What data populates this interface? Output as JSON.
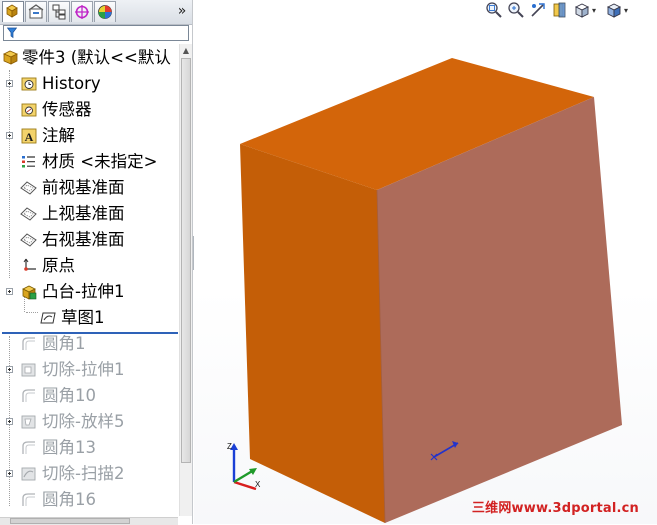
{
  "feature_tree": {
    "root": {
      "label": "零件3 (默认<<默认"
    },
    "items": [
      {
        "label": "History",
        "icon": "history-folder-icon",
        "state": "active"
      },
      {
        "label": "传感器",
        "icon": "sensors-icon",
        "state": "active"
      },
      {
        "label": "注解",
        "icon": "annotations-icon",
        "state": "active"
      },
      {
        "label": "材质 <未指定>",
        "icon": "material-icon",
        "state": "active"
      },
      {
        "label": "前视基准面",
        "icon": "plane-icon",
        "state": "active"
      },
      {
        "label": "上视基准面",
        "icon": "plane-icon",
        "state": "active"
      },
      {
        "label": "右视基准面",
        "icon": "plane-icon",
        "state": "active"
      },
      {
        "label": "原点",
        "icon": "origin-icon",
        "state": "active"
      },
      {
        "label": "凸台-拉伸1",
        "icon": "boss-extrude-icon",
        "state": "active"
      },
      {
        "label": "草图1",
        "icon": "sketch-icon",
        "state": "active"
      },
      {
        "label": "圆角1",
        "icon": "fillet-icon",
        "state": "suppressed"
      },
      {
        "label": "切除-拉伸1",
        "icon": "cut-extrude-icon",
        "state": "suppressed"
      },
      {
        "label": "圆角10",
        "icon": "fillet-icon",
        "state": "suppressed"
      },
      {
        "label": "切除-放样5",
        "icon": "cut-loft-icon",
        "state": "suppressed"
      },
      {
        "label": "圆角13",
        "icon": "fillet-icon",
        "state": "suppressed"
      },
      {
        "label": "切除-扫描2",
        "icon": "cut-sweep-icon",
        "state": "suppressed"
      },
      {
        "label": "圆角16",
        "icon": "fillet-icon",
        "state": "suppressed"
      }
    ]
  },
  "panel_tabs": [
    {
      "name": "feature-manager",
      "icon": "feature-tree-icon"
    },
    {
      "name": "property-manager",
      "icon": "property-manager-icon"
    },
    {
      "name": "configuration-manager",
      "icon": "configuration-icon"
    },
    {
      "name": "dimxpert-manager",
      "icon": "dimxpert-icon"
    },
    {
      "name": "display-manager",
      "icon": "appearance-icon"
    }
  ],
  "panel_collapse_label": "»",
  "filter_icon": "filter-icon",
  "viewport": {
    "toolbar": [
      "zoom-to-fit-icon",
      "zoom-to-area-icon",
      "previous-view-icon",
      "section-view-icon",
      "view-orientation-icon",
      "display-style-icon"
    ],
    "watermark": "三维网www.3dportal.cn",
    "triad_labels": {
      "y": "Z",
      "x": "X"
    },
    "colors": {
      "top_face": "#d3650a",
      "left_face": "#c45e07",
      "right_face": "#ad6b5a",
      "watermark": "#d22222"
    }
  }
}
